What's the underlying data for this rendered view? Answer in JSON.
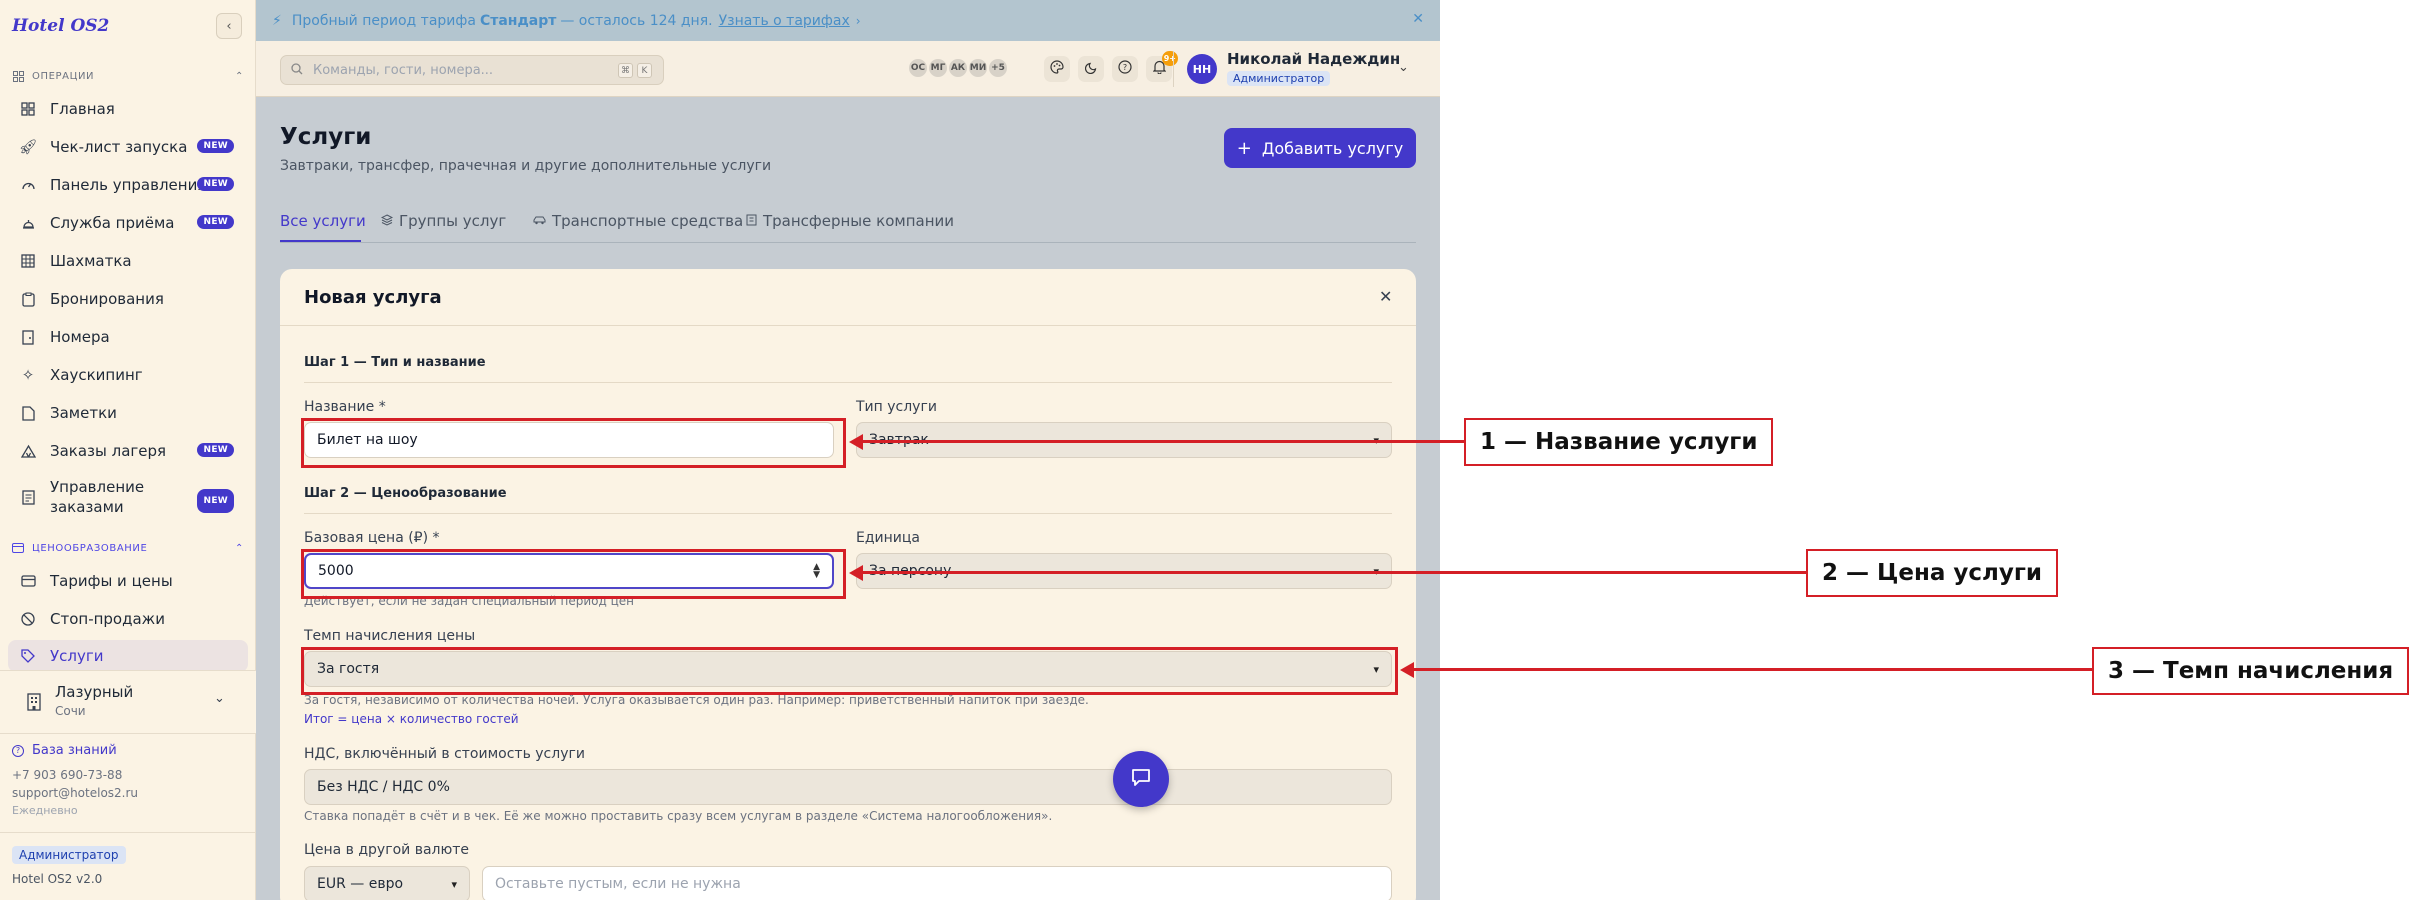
{
  "sidebar": {
    "logo": "Hotel OS2",
    "section_ops": "ОПЕРАЦИИ",
    "section_pricing": "ЦЕНООБРАЗОВАНИЕ",
    "items": [
      {
        "label": "Главная",
        "badge": ""
      },
      {
        "label": "Чек-лист запуска",
        "badge": "NEW"
      },
      {
        "label": "Панель управления",
        "badge": "NEW"
      },
      {
        "label": "Служба приёма",
        "badge": "NEW"
      },
      {
        "label": "Шахматка",
        "badge": ""
      },
      {
        "label": "Бронирования",
        "badge": ""
      },
      {
        "label": "Номера",
        "badge": ""
      },
      {
        "label": "Хаускипинг",
        "badge": ""
      },
      {
        "label": "Заметки",
        "badge": ""
      },
      {
        "label": "Заказы лагеря",
        "badge": "NEW"
      },
      {
        "label": "Управление заказами",
        "badge": "NEW"
      }
    ],
    "pricing_items": [
      {
        "label": "Тарифы и цены"
      },
      {
        "label": "Стоп-продажи"
      },
      {
        "label": "Услуги"
      }
    ],
    "hotel_name": "Лазурный",
    "hotel_city": "Сочи",
    "knowledge_base": "База знаний",
    "phone": "+7 903 690-73-88",
    "email": "support@hotelos2.ru",
    "schedule": "Ежедневно",
    "role": "Администратор",
    "version": "Hotel OS2 v2.0"
  },
  "trial": {
    "prefix": "Пробный период тарифа",
    "plan": "Стандарт",
    "suffix": "— осталось 124 дня.",
    "link": "Узнать о тарифах"
  },
  "topbar": {
    "search_placeholder": "Команды, гости, номера...",
    "kbd1": "⌘",
    "kbd2": "K",
    "avatars": [
      "ОС",
      "МГ",
      "АК",
      "МИ",
      "+5"
    ],
    "notifications": "9+",
    "user_initials": "НН",
    "user_name": "Николай Надеждин",
    "user_role": "Администратор"
  },
  "page": {
    "title": "Услуги",
    "subtitle": "Завтраки, трансфер, прачечная и другие дополнительные услуги",
    "add_button": "Добавить услугу",
    "tabs": [
      "Все услуги",
      "Группы услуг",
      "Транспортные средства",
      "Трансферные компании"
    ]
  },
  "form": {
    "title": "Новая услуга",
    "step1": "Шаг 1 — Тип и название",
    "name_label": "Название *",
    "name_value": "Билет на шоу",
    "type_label": "Тип услуги",
    "type_value": "Завтрак",
    "step2": "Шаг 2 — Ценообразование",
    "price_label": "Базовая цена (₽) *",
    "price_value": "5000",
    "unit_label": "Единица",
    "unit_value": "За персону",
    "price_hint": "Действует, если не задан специальный период цен",
    "rate_label": "Темп начисления цены",
    "rate_value": "За гостя",
    "rate_hint": "За гостя, независимо от количества ночей. Услуга оказывается один раз. Например: приветственный напиток при заезде.",
    "rate_formula": "Итог = цена × количество гостей",
    "vat_label": "НДС, включённый в стоимость услуги",
    "vat_value": "Без НДС / НДС 0%",
    "vat_hint": "Ставка попадёт в счёт и в чек. Её же можно проставить сразу всем услугам в разделе «Система налогообложения».",
    "currency_label": "Цена в другой валюте",
    "currency_value": "EUR — евро",
    "currency_placeholder": "Оставьте пустым, если не нужна"
  },
  "annotations": [
    {
      "label": "1 — Название услуги"
    },
    {
      "label": "2 — Цена услуги"
    },
    {
      "label": "3 — Темп начисления"
    }
  ],
  "colors": {
    "accent": "#4338ca",
    "annotation": "#d41f26",
    "trial_text": "#4a8fc7"
  }
}
